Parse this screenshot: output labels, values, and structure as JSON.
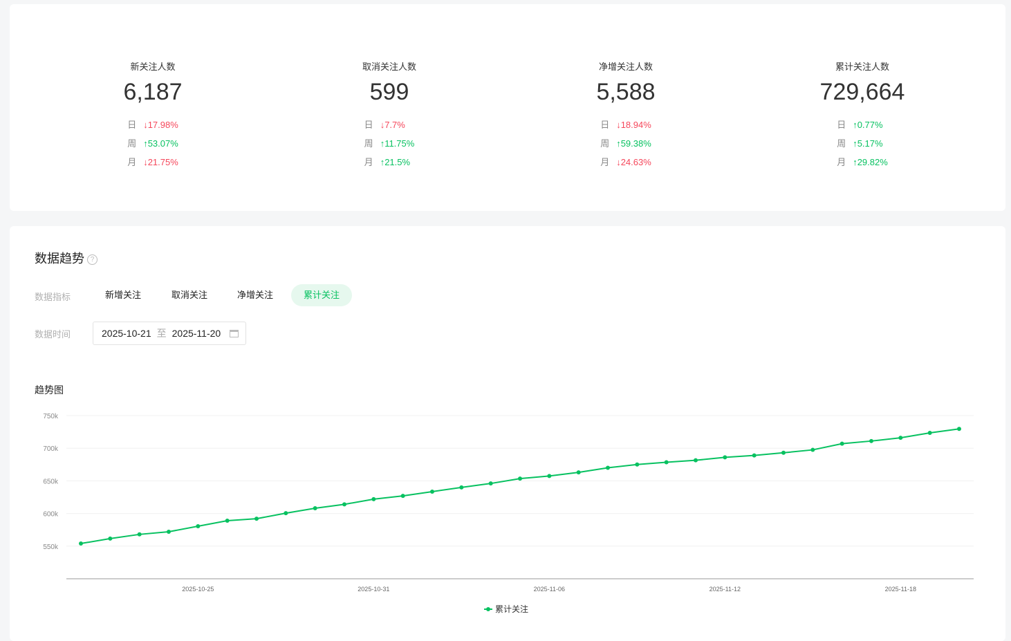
{
  "stats": [
    {
      "label": "新关注人数",
      "value": "6,187",
      "rows": [
        {
          "p": "日",
          "dir": "down",
          "arrow": "↓",
          "v": "17.98%"
        },
        {
          "p": "周",
          "dir": "up",
          "arrow": "↑",
          "v": "53.07%"
        },
        {
          "p": "月",
          "dir": "down",
          "arrow": "↓",
          "v": "21.75%"
        }
      ]
    },
    {
      "label": "取消关注人数",
      "value": "599",
      "rows": [
        {
          "p": "日",
          "dir": "down",
          "arrow": "↓",
          "v": "7.7%"
        },
        {
          "p": "周",
          "dir": "up",
          "arrow": "↑",
          "v": "11.75%"
        },
        {
          "p": "月",
          "dir": "up",
          "arrow": "↑",
          "v": "21.5%"
        }
      ]
    },
    {
      "label": "净增关注人数",
      "value": "5,588",
      "rows": [
        {
          "p": "日",
          "dir": "down",
          "arrow": "↓",
          "v": "18.94%"
        },
        {
          "p": "周",
          "dir": "up",
          "arrow": "↑",
          "v": "59.38%"
        },
        {
          "p": "月",
          "dir": "down",
          "arrow": "↓",
          "v": "24.63%"
        }
      ]
    },
    {
      "label": "累计关注人数",
      "value": "729,664",
      "rows": [
        {
          "p": "日",
          "dir": "up",
          "arrow": "↑",
          "v": "0.77%"
        },
        {
          "p": "周",
          "dir": "up",
          "arrow": "↑",
          "v": "5.17%"
        },
        {
          "p": "月",
          "dir": "up",
          "arrow": "↑",
          "v": "29.82%"
        }
      ]
    }
  ],
  "trend": {
    "title": "数据趋势",
    "help": "?",
    "metric_label": "数据指标",
    "tabs": [
      "新增关注",
      "取消关注",
      "净增关注",
      "累计关注"
    ],
    "active_tab": 3,
    "time_label": "数据时间",
    "date_start": "2025-10-21",
    "date_sep": "至",
    "date_end": "2025-11-20",
    "chart_title": "趋势图"
  },
  "colors": {
    "accent": "#07c160",
    "down": "#f5475b"
  },
  "chart_data": {
    "type": "line",
    "title": "趋势图",
    "x_start": "2025-10-21",
    "xtick_labels": [
      "2025-10-25",
      "2025-10-31",
      "2025-11-06",
      "2025-11-12",
      "2025-11-18"
    ],
    "xtick_indices": [
      4,
      10,
      16,
      22,
      28
    ],
    "ytick_labels": [
      "550k",
      "600k",
      "650k",
      "700k",
      "750k"
    ],
    "yticks": [
      550000,
      600000,
      650000,
      700000,
      750000
    ],
    "ylim": [
      500000,
      750000
    ],
    "series": [
      {
        "name": "累计关注",
        "values": [
          554000,
          561600,
          568000,
          572000,
          580500,
          589000,
          592000,
          600500,
          608000,
          614000,
          622000,
          627000,
          633500,
          640000,
          646000,
          653500,
          657500,
          663000,
          670000,
          675000,
          678500,
          681500,
          686000,
          689000,
          693000,
          697500,
          707000,
          711000,
          716000,
          723500,
          729664
        ]
      }
    ],
    "legend": "bottom-center",
    "grid": true
  }
}
